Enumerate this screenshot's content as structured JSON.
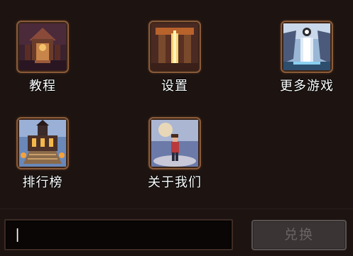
{
  "menu": {
    "items": [
      {
        "id": "tutorial",
        "label": "教程",
        "icon": "temple-icon"
      },
      {
        "id": "settings",
        "label": "设置",
        "icon": "gate-icon"
      },
      {
        "id": "more_games",
        "label": "更多游戏",
        "icon": "waterfall-icon"
      },
      {
        "id": "leaderboard",
        "label": "排行榜",
        "icon": "castle-icon"
      },
      {
        "id": "about",
        "label": "关于我们",
        "icon": "hero-icon"
      }
    ]
  },
  "redeem": {
    "input_value": "",
    "input_caret": "|",
    "button_label": "兑换"
  },
  "colors": {
    "background": "#1d1412",
    "frame": "#5a3a26",
    "button_disabled": "#3a3534"
  }
}
